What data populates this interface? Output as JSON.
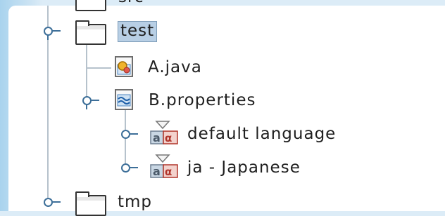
{
  "tree": {
    "nodes": [
      {
        "label": "src",
        "icon": "folder-icon"
      },
      {
        "label": "test",
        "icon": "folder-icon",
        "expanded": true,
        "selected": true
      },
      {
        "label": "A.java",
        "icon": "java-class-icon"
      },
      {
        "label": "B.properties",
        "icon": "properties-file-icon",
        "expanded": true
      },
      {
        "label": "default language",
        "icon": "locale-icon",
        "expanded": false
      },
      {
        "label": "ja - Japanese",
        "icon": "locale-icon",
        "expanded": false
      },
      {
        "label": "tmp",
        "icon": "folder-icon",
        "expanded": false
      }
    ]
  },
  "colors": {
    "selection": "#b8cfe5",
    "tree_lines": "#b6c2cc",
    "expander": "#3d6f99",
    "backdrop": "#cfe4f3"
  }
}
